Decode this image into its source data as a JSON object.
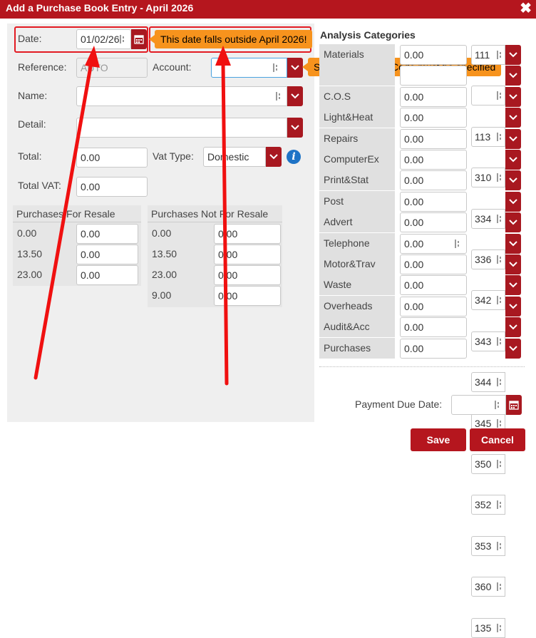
{
  "dialog": {
    "title": "Add a Purchase Book Entry - April 2026",
    "close_symbol": "✖"
  },
  "form": {
    "date_label": "Date:",
    "date_value": "01/02/26",
    "reference_label": "Reference:",
    "reference_value": "AUTO",
    "account_label": "Account:",
    "account_value": "",
    "name_label": "Name:",
    "name_value": "",
    "detail_label": "Detail:",
    "detail_value": "",
    "total_label": "Total:",
    "total_value": "0.00",
    "vat_type_label": "Vat Type:",
    "vat_type_value": "Domestic",
    "total_vat_label": "Total VAT:",
    "total_vat_value": "0.00"
  },
  "tooltips": {
    "date_error": "This date falls outside April 2026!",
    "account_error": "Supplier Account Code must be specified"
  },
  "resale": {
    "header": "Purchases For Resale",
    "rows": [
      {
        "rate": "0.00",
        "value": "0.00"
      },
      {
        "rate": "13.50",
        "value": "0.00"
      },
      {
        "rate": "23.00",
        "value": "0.00"
      }
    ]
  },
  "not_resale": {
    "header": "Purchases Not For Resale",
    "rows": [
      {
        "rate": "0.00",
        "value": "0.00"
      },
      {
        "rate": "13.50",
        "value": "0.00"
      },
      {
        "rate": "23.00",
        "value": "0.00"
      },
      {
        "rate": "9.00",
        "value": "0.00"
      }
    ]
  },
  "analysis": {
    "header": "Analysis Categories",
    "rows": [
      {
        "label": "Materials",
        "value": "0.00",
        "code": "111"
      },
      {
        "label": "",
        "value": "",
        "code": ""
      },
      {
        "label": "C.O.S",
        "value": "0.00",
        "code": "113"
      },
      {
        "label": "Light&Heat",
        "value": "0.00",
        "code": "310"
      },
      {
        "label": "Repairs",
        "value": "0.00",
        "code": "334"
      },
      {
        "label": "ComputerEx",
        "value": "0.00",
        "code": "336"
      },
      {
        "label": "Print&Stat",
        "value": "0.00",
        "code": "342"
      },
      {
        "label": "Post",
        "value": "0.00",
        "code": "343"
      },
      {
        "label": "Advert",
        "value": "0.00",
        "code": "344"
      },
      {
        "label": "Telephone",
        "value": "0.00",
        "code": "345"
      },
      {
        "label": "Motor&Trav",
        "value": "0.00",
        "code": "350"
      },
      {
        "label": "Waste",
        "value": "0.00",
        "code": "352"
      },
      {
        "label": "Overheads",
        "value": "0.00",
        "code": "353"
      },
      {
        "label": "Audit&Acc",
        "value": "0.00",
        "code": "360"
      },
      {
        "label": "Purchases",
        "value": "0.00",
        "code": "135"
      }
    ]
  },
  "footer": {
    "payment_due_label": "Payment Due Date:",
    "payment_due_value": "",
    "save_label": "Save",
    "cancel_label": "Cancel"
  },
  "colors": {
    "brand": "#b5161e",
    "tooltip": "#f7931d",
    "highlight": "#e31b23",
    "info": "#1e73c6"
  }
}
